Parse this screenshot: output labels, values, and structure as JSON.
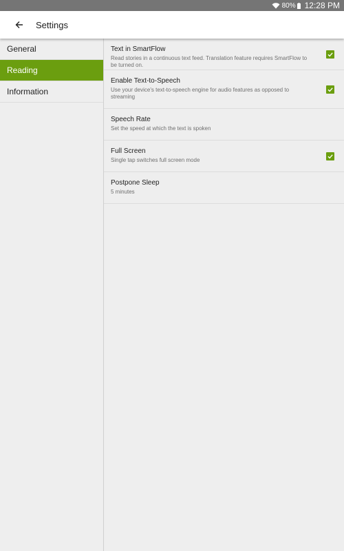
{
  "status_bar": {
    "battery": "80%",
    "time": "12:28 PM"
  },
  "app_bar": {
    "back_icon": "arrow-left-icon",
    "title": "Settings"
  },
  "sidebar": {
    "items": [
      {
        "label": "General",
        "active": false
      },
      {
        "label": "Reading",
        "active": true
      },
      {
        "label": "Information",
        "active": false
      }
    ]
  },
  "preferences": [
    {
      "title": "Text in SmartFlow",
      "summary": "Read stories in a continuous text feed. Translation feature requires SmartFlow to be turned on.",
      "checked": true
    },
    {
      "title": "Enable Text-to-Speech",
      "summary": "Use your device's text-to-speech engine for audio features as opposed to streaming",
      "checked": true
    },
    {
      "title": "Speech Rate",
      "summary": "Set the speed at which the text is spoken",
      "checked": null
    },
    {
      "title": "Full Screen",
      "summary": "Single tap switches full screen mode",
      "checked": true
    },
    {
      "title": "Postpone Sleep",
      "summary": "5 minutes",
      "checked": null
    }
  ],
  "colors": {
    "accent": "#6b9e0f",
    "status_bar": "#757575",
    "background": "#eeeeee"
  }
}
